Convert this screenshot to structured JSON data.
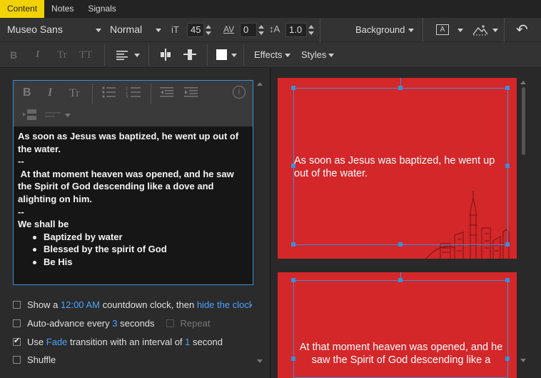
{
  "tabs": [
    {
      "label": "Content"
    },
    {
      "label": "Notes"
    },
    {
      "label": "Signals"
    }
  ],
  "toolbar1": {
    "font_family": "Museo Sans",
    "font_weight": "Normal",
    "font_size_icon": "iT",
    "font_size": "45",
    "tracking_icon": "AV",
    "tracking": "0",
    "line_height_icon": "↕A",
    "line_height": "1.0",
    "background_label": "Background",
    "undo_icon": "↶"
  },
  "toolbar2": {
    "bold": "B",
    "italic": "I",
    "smallcaps": "Tr",
    "allcaps": "TT",
    "effects_label": "Effects",
    "styles_label": "Styles",
    "fill_color": "#ffffff"
  },
  "editor": {
    "toolbar": {
      "bold": "B",
      "italic": "I",
      "smallcaps": "Tr",
      "info": "i"
    },
    "lines": [
      "As soon as Jesus was baptized, he went up out of the water.",
      "--",
      " At that moment heaven was opened, and he saw the Spirit of God descending like a dove and alighting on him.",
      "--",
      "We shall be"
    ],
    "bullets": [
      "Baptized by water",
      "Blessed by the spirit of God",
      "Be His"
    ]
  },
  "options": {
    "countdown": {
      "pre": "Show a",
      "time": "12:00 AM",
      "mid": "countdown clock, then",
      "action": "hide the clock",
      "checked": false
    },
    "auto_advance": {
      "pre": "Auto-advance every",
      "value": "3",
      "post": "seconds",
      "repeat_label": "Repeat",
      "checked": false
    },
    "transition": {
      "pre": "Use",
      "type": "Fade",
      "mid": "transition with an interval of",
      "value": "1",
      "post": "second",
      "checked": true
    },
    "shuffle": {
      "label": "Shuffle",
      "checked": false
    }
  },
  "slides": [
    {
      "text": "As soon as Jesus was baptized, he went up out of the water."
    },
    {
      "text": "At that moment heaven was opened, and he saw the Spirit of God descending like a"
    }
  ],
  "colors": {
    "accent_yellow": "#f2d200",
    "accent_blue": "#3b8fd9",
    "slide_red": "#d3272a"
  }
}
